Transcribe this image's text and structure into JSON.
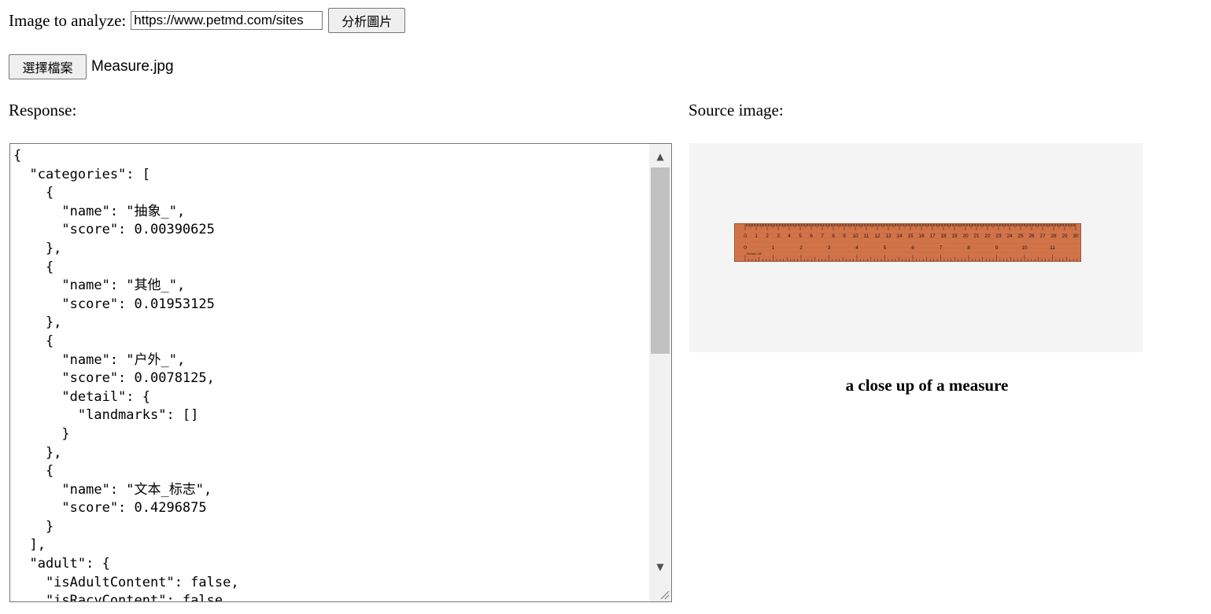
{
  "form": {
    "image_label": "Image to analyze:",
    "url_value": "https://www.petmd.com/sites",
    "analyze_button": "分析圖片",
    "file_button": "選擇檔案",
    "file_name": "Measure.jpg"
  },
  "response": {
    "label": "Response:",
    "text": "{\n  \"categories\": [\n    {\n      \"name\": \"抽象_\",\n      \"score\": 0.00390625\n    },\n    {\n      \"name\": \"其他_\",\n      \"score\": 0.01953125\n    },\n    {\n      \"name\": \"户外_\",\n      \"score\": 0.0078125,\n      \"detail\": {\n        \"landmarks\": []\n      }\n    },\n    {\n      \"name\": \"文本_标志\",\n      \"score\": 0.4296875\n    }\n  ],\n  \"adult\": {\n    \"isAdultContent\": false,\n    \"isRacyContent\": false,"
  },
  "source": {
    "label": "Source image:",
    "caption": "a close up of a measure",
    "ruler_cm_labels": [
      "0",
      "1",
      "2",
      "3",
      "4",
      "5",
      "6",
      "7",
      "8",
      "9",
      "10",
      "11",
      "12",
      "13",
      "14",
      "15",
      "16",
      "17",
      "18",
      "19",
      "20",
      "21",
      "22",
      "23",
      "24",
      "25",
      "26",
      "27",
      "28",
      "29",
      "30"
    ],
    "ruler_inch_labels": [
      "0",
      "1",
      "2",
      "3",
      "4",
      "5",
      "6",
      "7",
      "8",
      "9",
      "10",
      "11"
    ],
    "ruler_small_label": "Inches 1/8",
    "ruler_color": "#d2744a"
  },
  "icons": {
    "scroll_up": "triangle-up-icon",
    "scroll_down": "triangle-down-icon",
    "resize": "resize-grip-icon"
  }
}
